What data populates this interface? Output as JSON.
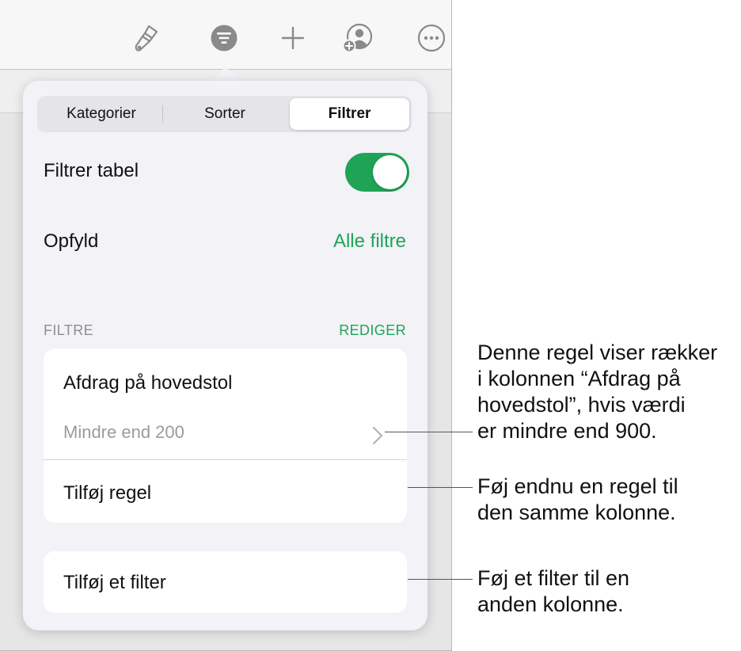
{
  "toolbar": {
    "icons": [
      "paintbrush-icon",
      "filter-icon",
      "plus-icon",
      "add-person-icon",
      "more-icon"
    ]
  },
  "segments": {
    "categories": "Kategorier",
    "sort": "Sorter",
    "filter": "Filtrer",
    "selected": "Filtrer"
  },
  "filter_table": {
    "label": "Filtrer tabel",
    "enabled": true
  },
  "match": {
    "label": "Opfyld",
    "value": "Alle filtre"
  },
  "filters_section": {
    "header": "FILTRE",
    "edit": "REDIGER"
  },
  "filter_card": {
    "column": "Afdrag på hovedstol",
    "rule": "Mindre end 200",
    "add_rule": "Tilføj regel"
  },
  "add_filter": "Tilføj et filter",
  "callouts": {
    "rule": [
      "Denne regel viser rækker",
      "i kolonnen “Afdrag på",
      "hovedstol”, hvis værdi",
      "er mindre end 900."
    ],
    "add_rule": [
      "Føj endnu en regel til",
      "den samme kolonne."
    ],
    "add_filter": [
      "Føj et filter til en",
      "anden kolonne."
    ]
  },
  "colors": {
    "accent": "#1fa456",
    "popover_bg": "#f2f2f7",
    "muted_text": "#9b9b9b"
  }
}
